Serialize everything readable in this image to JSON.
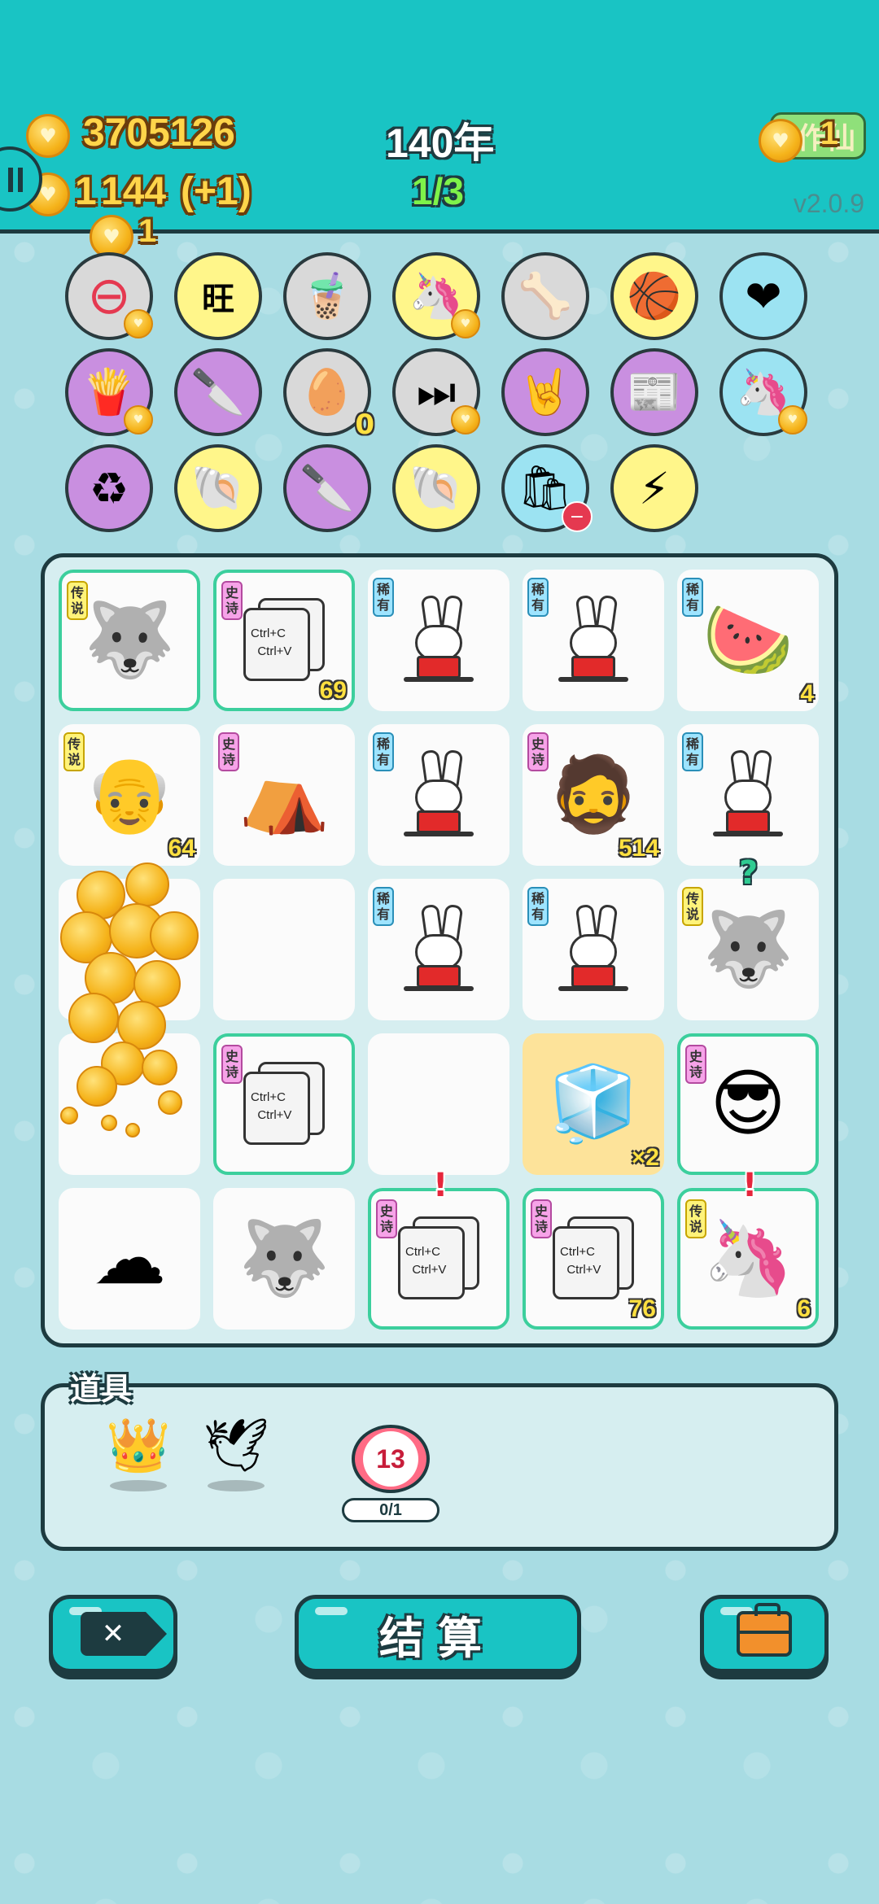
{
  "header": {
    "coins": "3705126",
    "coins_icon": "heart-coin-icon",
    "rent_text": "144",
    "rent_delta": "(+1)",
    "rent_prefix": "1",
    "year": "140年",
    "progress": "1/3",
    "extra_coin": "1",
    "cheat_label": "作仙",
    "cheat_coin": "1",
    "version": "v2.0.9"
  },
  "relics": [
    {
      "icon": "minus-circle-icon",
      "glyph": "⊖",
      "bg": "gray",
      "badge": "coin"
    },
    {
      "icon": "wang-tiles-icon",
      "glyph": "旺",
      "bg": "yellow",
      "badge": ""
    },
    {
      "icon": "bubble-tea-icon",
      "glyph": "🧋",
      "bg": "gray",
      "badge": ""
    },
    {
      "icon": "unicorn-icon",
      "glyph": "🦄",
      "bg": "yellow",
      "badge": "coin"
    },
    {
      "icon": "dog-bowl-icon",
      "glyph": "🦴",
      "bg": "gray",
      "badge": ""
    },
    {
      "icon": "basketballs-icon",
      "glyph": "🏀",
      "bg": "yellow",
      "badge": ""
    },
    {
      "icon": "heart-iv-bag-icon",
      "glyph": "❤",
      "bg": "blue",
      "badge": ""
    },
    {
      "icon": "fries-icon",
      "glyph": "🍟",
      "bg": "purple",
      "badge": "coin"
    },
    {
      "icon": "cleaver-icon",
      "glyph": "🔪",
      "bg": "purple",
      "badge": ""
    },
    {
      "icon": "egg-tray-icon",
      "glyph": "🥚",
      "bg": "gray",
      "badge": "count",
      "count": "0"
    },
    {
      "icon": "skip-icon",
      "glyph": "⏭",
      "bg": "gray",
      "badge": "coin"
    },
    {
      "icon": "rock-hand-icon",
      "glyph": "🤘",
      "bg": "purple",
      "badge": ""
    },
    {
      "icon": "time-magazine-icon",
      "glyph": "📰",
      "bg": "purple",
      "badge": ""
    },
    {
      "icon": "twin-unicorns-icon",
      "glyph": "🦄",
      "bg": "blue",
      "badge": "coin"
    },
    {
      "icon": "recycle-icon",
      "glyph": "♻",
      "bg": "purple",
      "badge": ""
    },
    {
      "icon": "shell-icon",
      "glyph": "🐚",
      "bg": "yellow",
      "badge": ""
    },
    {
      "icon": "cleaver-icon",
      "glyph": "🔪",
      "bg": "purple",
      "badge": ""
    },
    {
      "icon": "shell-icon",
      "glyph": "🐚",
      "bg": "yellow",
      "badge": ""
    },
    {
      "icon": "trash-bag-icon",
      "glyph": "🛍",
      "bg": "blue",
      "badge": "minus"
    },
    {
      "icon": "lightning-icon",
      "glyph": "⚡",
      "bg": "yellow",
      "badge": ""
    }
  ],
  "board": [
    {
      "tag": "传说",
      "rarity": "leg",
      "symbol": "husky-king",
      "count": "",
      "frame": true
    },
    {
      "tag": "史诗",
      "rarity": "epic",
      "symbol": "copy-paste",
      "count": "69",
      "frame": true
    },
    {
      "tag": "稀有",
      "rarity": "rare",
      "symbol": "rabbit",
      "count": "",
      "frame": false
    },
    {
      "tag": "稀有",
      "rarity": "rare",
      "symbol": "rabbit",
      "count": "",
      "frame": false
    },
    {
      "tag": "稀有",
      "rarity": "rare",
      "symbol": "watermelon",
      "count": "4",
      "frame": false
    },
    {
      "tag": "传说",
      "rarity": "leg",
      "symbol": "old-man",
      "count": "64",
      "frame": false
    },
    {
      "tag": "史诗",
      "rarity": "epic",
      "symbol": "rabbit-house",
      "count": "",
      "frame": false
    },
    {
      "tag": "稀有",
      "rarity": "rare",
      "symbol": "rabbit",
      "count": "",
      "frame": false
    },
    {
      "tag": "史诗",
      "rarity": "epic",
      "symbol": "bearded-man",
      "count": "514",
      "frame": false
    },
    {
      "tag": "稀有",
      "rarity": "rare",
      "symbol": "rabbit",
      "count": "",
      "frame": false
    },
    {
      "tag": "",
      "rarity": "",
      "symbol": "coins",
      "count": "",
      "frame": false
    },
    {
      "tag": "",
      "rarity": "",
      "symbol": "empty",
      "count": "",
      "frame": false
    },
    {
      "tag": "稀有",
      "rarity": "rare",
      "symbol": "rabbit",
      "count": "",
      "frame": false
    },
    {
      "tag": "稀有",
      "rarity": "rare",
      "symbol": "rabbit",
      "count": "",
      "frame": false
    },
    {
      "tag": "传说",
      "rarity": "leg",
      "symbol": "husky-king",
      "count": "",
      "frame": false,
      "mark": "?"
    },
    {
      "tag": "",
      "rarity": "",
      "symbol": "coins",
      "count": "",
      "frame": false
    },
    {
      "tag": "史诗",
      "rarity": "epic",
      "symbol": "copy-paste",
      "count": "",
      "frame": true
    },
    {
      "tag": "",
      "rarity": "",
      "symbol": "empty",
      "count": "",
      "frame": false
    },
    {
      "tag": "",
      "rarity": "",
      "symbol": "fridge",
      "count": "×2",
      "frame": false,
      "yellow": true
    },
    {
      "tag": "史诗",
      "rarity": "epic",
      "symbol": "sunglasses-man",
      "count": "",
      "frame": true
    },
    {
      "tag": "",
      "rarity": "",
      "symbol": "cotton",
      "count": "",
      "frame": false
    },
    {
      "tag": "",
      "rarity": "",
      "symbol": "husky-king",
      "count": "",
      "frame": false
    },
    {
      "tag": "史诗",
      "rarity": "epic",
      "symbol": "copy-paste",
      "count": "",
      "frame": true,
      "mark": "!"
    },
    {
      "tag": "史诗",
      "rarity": "epic",
      "symbol": "copy-paste",
      "count": "76",
      "frame": true
    },
    {
      "tag": "传说",
      "rarity": "leg",
      "symbol": "unicorn",
      "count": "6",
      "frame": true,
      "mark": "!"
    }
  ],
  "copy_text": {
    "line1": "Ctrl+C",
    "line2": "Ctrl+V"
  },
  "items": {
    "title": "道具",
    "list": [
      {
        "icon": "crown-icon",
        "glyph": "👑"
      },
      {
        "icon": "dove-icon",
        "glyph": "🕊"
      },
      {
        "icon": "timer-icon",
        "value": "13",
        "progress": "0/1"
      }
    ]
  },
  "buttons": {
    "remove_icon": "✕",
    "settle_label": "结算",
    "bag_icon": "briefcase-icon"
  },
  "colors": {
    "accent": "#19c4c4",
    "outline": "#1d3b40",
    "gold": "#ffd54a",
    "green": "#7ef24a"
  }
}
